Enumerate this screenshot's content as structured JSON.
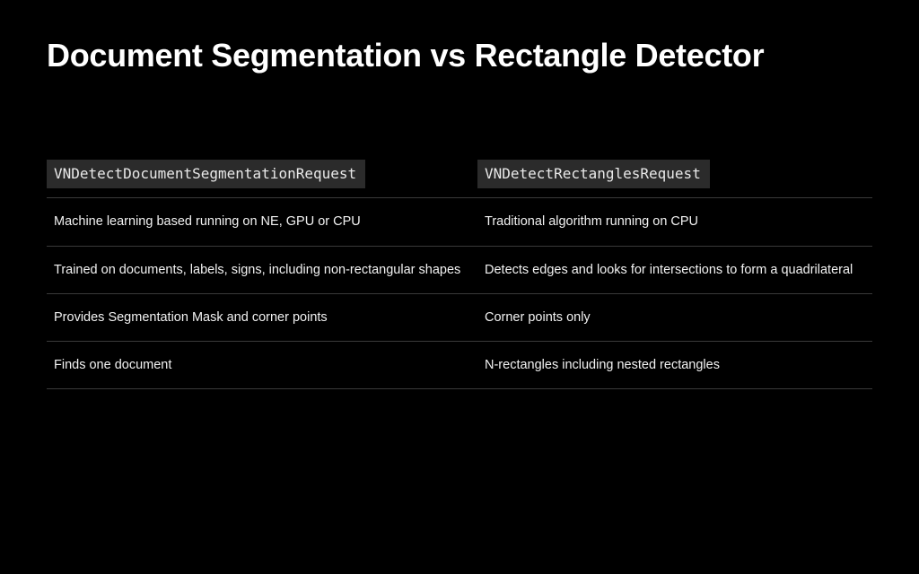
{
  "title": "Document Segmentation vs Rectangle Detector",
  "table": {
    "col_left_header": "VNDetectDocumentSegmentationRequest",
    "col_right_header": "VNDetectRectanglesRequest",
    "rows": [
      {
        "left": "Machine learning based running on NE, GPU or CPU",
        "right": "Traditional algorithm running on CPU"
      },
      {
        "left": "Trained on documents, labels, signs, including non-rectangular shapes",
        "right": "Detects edges and looks for intersections to form a quadrilateral"
      },
      {
        "left": "Provides Segmentation Mask and corner points",
        "right": "Corner points only"
      },
      {
        "left": "Finds one document",
        "right": "N-rectangles including nested rectangles"
      }
    ]
  }
}
